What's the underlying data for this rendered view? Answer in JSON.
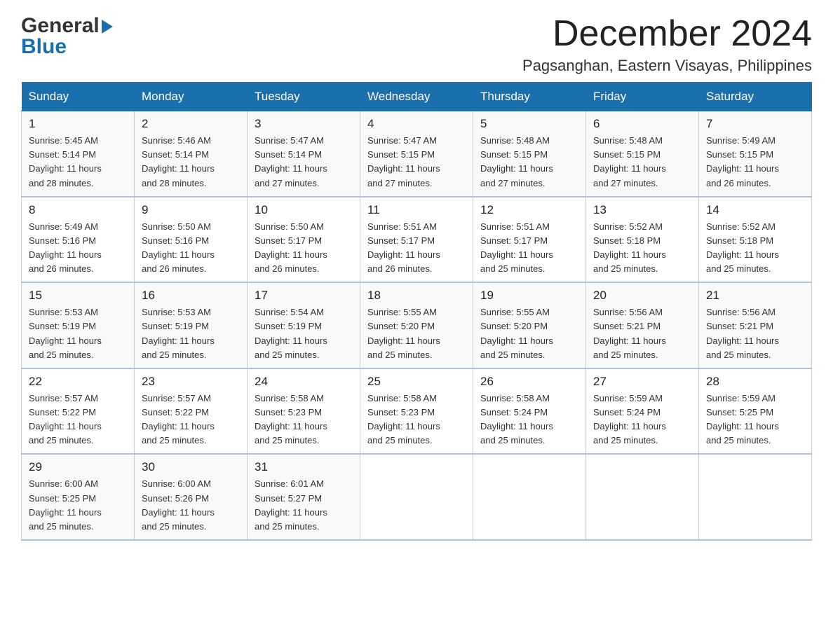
{
  "header": {
    "logo_text_general": "General",
    "logo_text_blue": "Blue",
    "calendar_title": "December 2024",
    "calendar_subtitle": "Pagsanghan, Eastern Visayas, Philippines"
  },
  "days_of_week": [
    "Sunday",
    "Monday",
    "Tuesday",
    "Wednesday",
    "Thursday",
    "Friday",
    "Saturday"
  ],
  "weeks": [
    [
      {
        "day": "1",
        "sunrise": "5:45 AM",
        "sunset": "5:14 PM",
        "daylight": "11 hours and 28 minutes."
      },
      {
        "day": "2",
        "sunrise": "5:46 AM",
        "sunset": "5:14 PM",
        "daylight": "11 hours and 28 minutes."
      },
      {
        "day": "3",
        "sunrise": "5:47 AM",
        "sunset": "5:14 PM",
        "daylight": "11 hours and 27 minutes."
      },
      {
        "day": "4",
        "sunrise": "5:47 AM",
        "sunset": "5:15 PM",
        "daylight": "11 hours and 27 minutes."
      },
      {
        "day": "5",
        "sunrise": "5:48 AM",
        "sunset": "5:15 PM",
        "daylight": "11 hours and 27 minutes."
      },
      {
        "day": "6",
        "sunrise": "5:48 AM",
        "sunset": "5:15 PM",
        "daylight": "11 hours and 27 minutes."
      },
      {
        "day": "7",
        "sunrise": "5:49 AM",
        "sunset": "5:15 PM",
        "daylight": "11 hours and 26 minutes."
      }
    ],
    [
      {
        "day": "8",
        "sunrise": "5:49 AM",
        "sunset": "5:16 PM",
        "daylight": "11 hours and 26 minutes."
      },
      {
        "day": "9",
        "sunrise": "5:50 AM",
        "sunset": "5:16 PM",
        "daylight": "11 hours and 26 minutes."
      },
      {
        "day": "10",
        "sunrise": "5:50 AM",
        "sunset": "5:17 PM",
        "daylight": "11 hours and 26 minutes."
      },
      {
        "day": "11",
        "sunrise": "5:51 AM",
        "sunset": "5:17 PM",
        "daylight": "11 hours and 26 minutes."
      },
      {
        "day": "12",
        "sunrise": "5:51 AM",
        "sunset": "5:17 PM",
        "daylight": "11 hours and 25 minutes."
      },
      {
        "day": "13",
        "sunrise": "5:52 AM",
        "sunset": "5:18 PM",
        "daylight": "11 hours and 25 minutes."
      },
      {
        "day": "14",
        "sunrise": "5:52 AM",
        "sunset": "5:18 PM",
        "daylight": "11 hours and 25 minutes."
      }
    ],
    [
      {
        "day": "15",
        "sunrise": "5:53 AM",
        "sunset": "5:19 PM",
        "daylight": "11 hours and 25 minutes."
      },
      {
        "day": "16",
        "sunrise": "5:53 AM",
        "sunset": "5:19 PM",
        "daylight": "11 hours and 25 minutes."
      },
      {
        "day": "17",
        "sunrise": "5:54 AM",
        "sunset": "5:19 PM",
        "daylight": "11 hours and 25 minutes."
      },
      {
        "day": "18",
        "sunrise": "5:55 AM",
        "sunset": "5:20 PM",
        "daylight": "11 hours and 25 minutes."
      },
      {
        "day": "19",
        "sunrise": "5:55 AM",
        "sunset": "5:20 PM",
        "daylight": "11 hours and 25 minutes."
      },
      {
        "day": "20",
        "sunrise": "5:56 AM",
        "sunset": "5:21 PM",
        "daylight": "11 hours and 25 minutes."
      },
      {
        "day": "21",
        "sunrise": "5:56 AM",
        "sunset": "5:21 PM",
        "daylight": "11 hours and 25 minutes."
      }
    ],
    [
      {
        "day": "22",
        "sunrise": "5:57 AM",
        "sunset": "5:22 PM",
        "daylight": "11 hours and 25 minutes."
      },
      {
        "day": "23",
        "sunrise": "5:57 AM",
        "sunset": "5:22 PM",
        "daylight": "11 hours and 25 minutes."
      },
      {
        "day": "24",
        "sunrise": "5:58 AM",
        "sunset": "5:23 PM",
        "daylight": "11 hours and 25 minutes."
      },
      {
        "day": "25",
        "sunrise": "5:58 AM",
        "sunset": "5:23 PM",
        "daylight": "11 hours and 25 minutes."
      },
      {
        "day": "26",
        "sunrise": "5:58 AM",
        "sunset": "5:24 PM",
        "daylight": "11 hours and 25 minutes."
      },
      {
        "day": "27",
        "sunrise": "5:59 AM",
        "sunset": "5:24 PM",
        "daylight": "11 hours and 25 minutes."
      },
      {
        "day": "28",
        "sunrise": "5:59 AM",
        "sunset": "5:25 PM",
        "daylight": "11 hours and 25 minutes."
      }
    ],
    [
      {
        "day": "29",
        "sunrise": "6:00 AM",
        "sunset": "5:25 PM",
        "daylight": "11 hours and 25 minutes."
      },
      {
        "day": "30",
        "sunrise": "6:00 AM",
        "sunset": "5:26 PM",
        "daylight": "11 hours and 25 minutes."
      },
      {
        "day": "31",
        "sunrise": "6:01 AM",
        "sunset": "5:27 PM",
        "daylight": "11 hours and 25 minutes."
      },
      null,
      null,
      null,
      null
    ]
  ],
  "labels": {
    "sunrise": "Sunrise:",
    "sunset": "Sunset:",
    "daylight": "Daylight:"
  }
}
